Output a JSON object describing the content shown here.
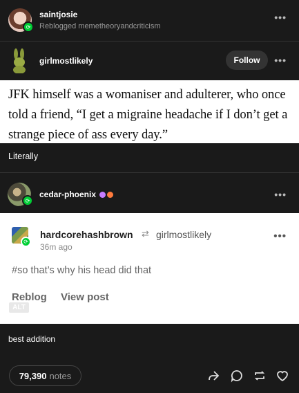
{
  "header": {
    "username": "saintjosie",
    "reblogged_prefix": "Reblogged",
    "reblogged_from": "memetheoryandcriticism"
  },
  "post_author": {
    "username": "girlmostlikely",
    "follow_label": "Follow"
  },
  "quote": {
    "text": "JFK himself was a womaniser and adulterer, who once told a friend, “I get a migraine headache if I don’t get a strange piece of ass every day.”"
  },
  "comment1": {
    "text": "Literally"
  },
  "reblogger": {
    "username": "cedar-phoenix"
  },
  "inner_post": {
    "username": "hardcorehashbrown",
    "reblogged_from": "girlmostlikely",
    "time": "36m ago",
    "tag": "#so that’s why his head did that",
    "reblog_label": "Reblog",
    "view_label": "View post",
    "alt_label": "ALT"
  },
  "comment2": {
    "text": "best addition"
  },
  "footer": {
    "notes_count": "79,390",
    "notes_label": "notes",
    "actions": [
      "share-icon",
      "reply-icon",
      "reblog-icon",
      "heart-icon"
    ]
  },
  "colors": {
    "background": "#1a1a1a",
    "reblog_green": "#00cf35"
  }
}
